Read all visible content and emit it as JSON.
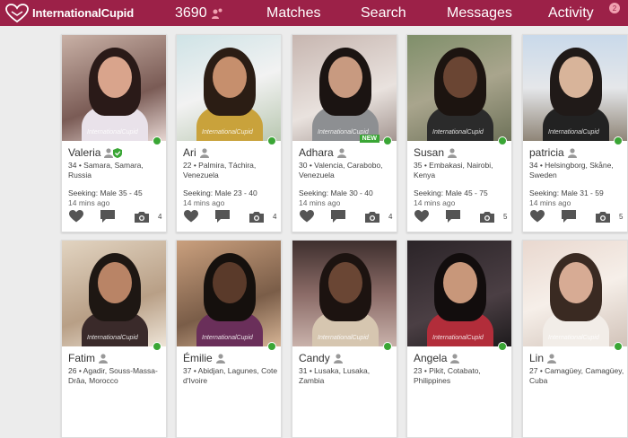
{
  "header": {
    "brand": "InternationalCupid",
    "count": "3690",
    "nav": [
      "Matches",
      "Search",
      "Messages",
      "Activity"
    ],
    "activity_badge": "2",
    "brand_color": "#9c2148"
  },
  "profiles": [
    {
      "name": "Valeria",
      "loc": "34 • Samara, Samara, Russia",
      "seeking": "Seeking: Male 35 - 45",
      "time": "14 mins ago",
      "photos": "4",
      "verified": true,
      "isnew": false
    },
    {
      "name": "Ari",
      "loc": "22 • Palmira, Táchira, Venezuela",
      "seeking": "Seeking: Male 23 - 40",
      "time": "14 mins ago",
      "photos": "4",
      "verified": false,
      "isnew": false
    },
    {
      "name": "Adhara",
      "loc": "30 • Valencia, Carabobo, Venezuela",
      "seeking": "Seeking: Male 30 - 40",
      "time": "14 mins ago",
      "photos": "4",
      "verified": false,
      "isnew": true,
      "new_label": "NEW"
    },
    {
      "name": "Susan",
      "loc": "35 • Embakasi, Nairobi, Kenya",
      "seeking": "Seeking: Male 45 - 75",
      "time": "14 mins ago",
      "photos": "5",
      "verified": false,
      "isnew": false
    },
    {
      "name": "patricia",
      "loc": "34 • Helsingborg, Skåne, Sweden",
      "seeking": "Seeking: Male 31 - 59",
      "time": "14 mins ago",
      "photos": "5",
      "verified": false,
      "isnew": false
    },
    {
      "name": "Fatim",
      "loc": "26 • Agadir, Souss-Massa-Drâa, Morocco",
      "seeking": "",
      "time": "",
      "photos": "",
      "verified": false,
      "isnew": false
    },
    {
      "name": "Émilie",
      "loc": "37 • Abidjan, Lagunes, Cote d'Ivoire",
      "seeking": "",
      "time": "",
      "photos": "",
      "verified": false,
      "isnew": false
    },
    {
      "name": "Candy",
      "loc": "31 • Lusaka, Lusaka, Zambia",
      "seeking": "",
      "time": "",
      "photos": "",
      "verified": false,
      "isnew": false
    },
    {
      "name": "Angela",
      "loc": "23 • Pikit, Cotabato, Philippines",
      "seeking": "",
      "time": "",
      "photos": "",
      "verified": false,
      "isnew": false
    },
    {
      "name": "Lin",
      "loc": "27 • Camagüey, Camagüey, Cuba",
      "seeking": "",
      "time": "",
      "photos": "",
      "verified": false,
      "isnew": false
    }
  ],
  "watermark": "InternationalCupid",
  "icons": [
    "heart-icon",
    "chat-icon",
    "camera-icon",
    "user-icon",
    "shield-check-icon",
    "cupid-logo-icon"
  ]
}
